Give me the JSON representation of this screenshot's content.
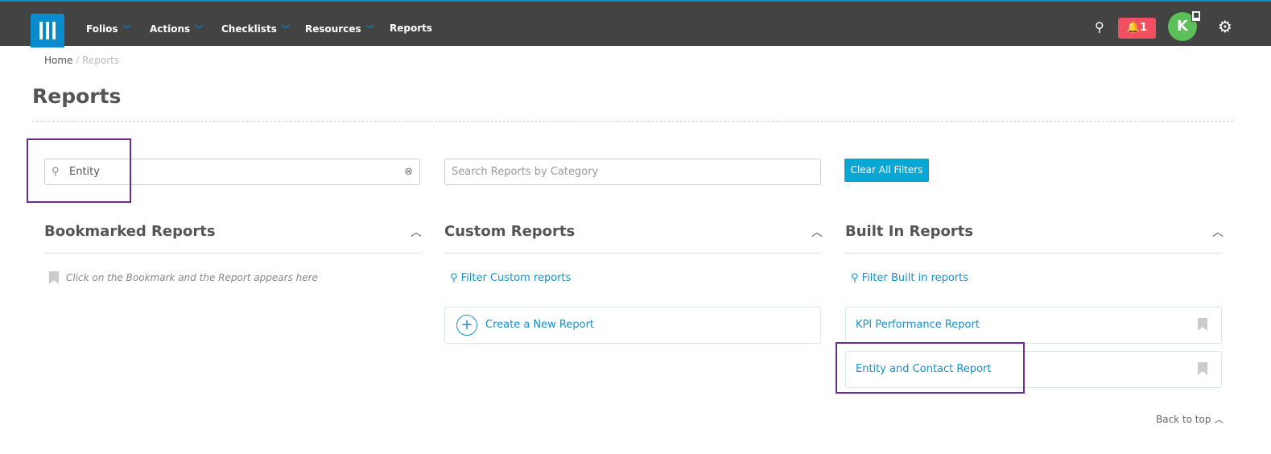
{
  "nav": {
    "items": [
      "Folios",
      "Actions",
      "Checklists",
      "Resources"
    ],
    "reports": "Reports",
    "notification_count": "1",
    "avatar_initial": "K"
  },
  "breadcrumb": {
    "home": "Home",
    "current": "Reports"
  },
  "page_title": "Reports",
  "filters": {
    "search_value": "Entity",
    "category_placeholder": "Search Reports by Category",
    "clear_label": "Clear All Filters"
  },
  "bookmarked": {
    "title": "Bookmarked Reports",
    "empty": "Click on the Bookmark and the Report appears here"
  },
  "custom": {
    "title": "Custom Reports",
    "filter": "Filter Custom reports",
    "create": "Create a New Report"
  },
  "builtin": {
    "title": "Built In Reports",
    "filter": "Filter Built in reports",
    "reports": [
      "KPI Performance Report",
      "Entity and Contact Report"
    ]
  },
  "back_to_top": "Back to top"
}
